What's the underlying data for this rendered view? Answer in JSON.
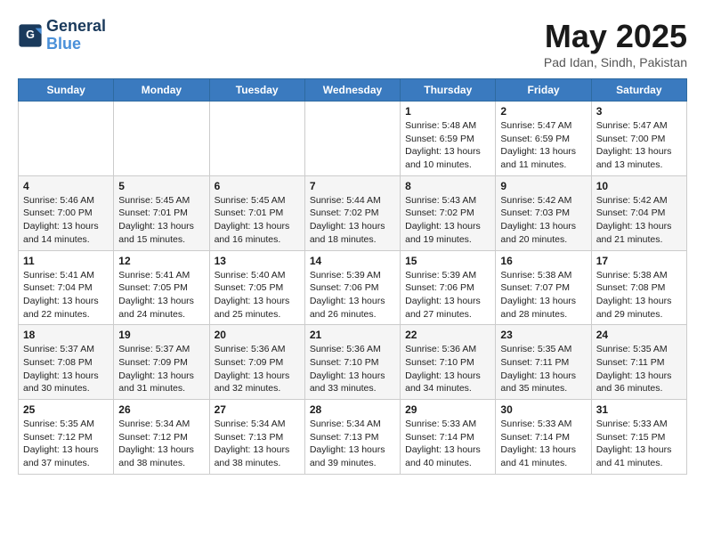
{
  "logo": {
    "line1": "General",
    "line2": "Blue"
  },
  "title": "May 2025",
  "location": "Pad Idan, Sindh, Pakistan",
  "headers": [
    "Sunday",
    "Monday",
    "Tuesday",
    "Wednesday",
    "Thursday",
    "Friday",
    "Saturday"
  ],
  "weeks": [
    [
      {
        "day": "",
        "info": ""
      },
      {
        "day": "",
        "info": ""
      },
      {
        "day": "",
        "info": ""
      },
      {
        "day": "",
        "info": ""
      },
      {
        "day": "1",
        "info": "Sunrise: 5:48 AM\nSunset: 6:59 PM\nDaylight: 13 hours\nand 10 minutes."
      },
      {
        "day": "2",
        "info": "Sunrise: 5:47 AM\nSunset: 6:59 PM\nDaylight: 13 hours\nand 11 minutes."
      },
      {
        "day": "3",
        "info": "Sunrise: 5:47 AM\nSunset: 7:00 PM\nDaylight: 13 hours\nand 13 minutes."
      }
    ],
    [
      {
        "day": "4",
        "info": "Sunrise: 5:46 AM\nSunset: 7:00 PM\nDaylight: 13 hours\nand 14 minutes."
      },
      {
        "day": "5",
        "info": "Sunrise: 5:45 AM\nSunset: 7:01 PM\nDaylight: 13 hours\nand 15 minutes."
      },
      {
        "day": "6",
        "info": "Sunrise: 5:45 AM\nSunset: 7:01 PM\nDaylight: 13 hours\nand 16 minutes."
      },
      {
        "day": "7",
        "info": "Sunrise: 5:44 AM\nSunset: 7:02 PM\nDaylight: 13 hours\nand 18 minutes."
      },
      {
        "day": "8",
        "info": "Sunrise: 5:43 AM\nSunset: 7:02 PM\nDaylight: 13 hours\nand 19 minutes."
      },
      {
        "day": "9",
        "info": "Sunrise: 5:42 AM\nSunset: 7:03 PM\nDaylight: 13 hours\nand 20 minutes."
      },
      {
        "day": "10",
        "info": "Sunrise: 5:42 AM\nSunset: 7:04 PM\nDaylight: 13 hours\nand 21 minutes."
      }
    ],
    [
      {
        "day": "11",
        "info": "Sunrise: 5:41 AM\nSunset: 7:04 PM\nDaylight: 13 hours\nand 22 minutes."
      },
      {
        "day": "12",
        "info": "Sunrise: 5:41 AM\nSunset: 7:05 PM\nDaylight: 13 hours\nand 24 minutes."
      },
      {
        "day": "13",
        "info": "Sunrise: 5:40 AM\nSunset: 7:05 PM\nDaylight: 13 hours\nand 25 minutes."
      },
      {
        "day": "14",
        "info": "Sunrise: 5:39 AM\nSunset: 7:06 PM\nDaylight: 13 hours\nand 26 minutes."
      },
      {
        "day": "15",
        "info": "Sunrise: 5:39 AM\nSunset: 7:06 PM\nDaylight: 13 hours\nand 27 minutes."
      },
      {
        "day": "16",
        "info": "Sunrise: 5:38 AM\nSunset: 7:07 PM\nDaylight: 13 hours\nand 28 minutes."
      },
      {
        "day": "17",
        "info": "Sunrise: 5:38 AM\nSunset: 7:08 PM\nDaylight: 13 hours\nand 29 minutes."
      }
    ],
    [
      {
        "day": "18",
        "info": "Sunrise: 5:37 AM\nSunset: 7:08 PM\nDaylight: 13 hours\nand 30 minutes."
      },
      {
        "day": "19",
        "info": "Sunrise: 5:37 AM\nSunset: 7:09 PM\nDaylight: 13 hours\nand 31 minutes."
      },
      {
        "day": "20",
        "info": "Sunrise: 5:36 AM\nSunset: 7:09 PM\nDaylight: 13 hours\nand 32 minutes."
      },
      {
        "day": "21",
        "info": "Sunrise: 5:36 AM\nSunset: 7:10 PM\nDaylight: 13 hours\nand 33 minutes."
      },
      {
        "day": "22",
        "info": "Sunrise: 5:36 AM\nSunset: 7:10 PM\nDaylight: 13 hours\nand 34 minutes."
      },
      {
        "day": "23",
        "info": "Sunrise: 5:35 AM\nSunset: 7:11 PM\nDaylight: 13 hours\nand 35 minutes."
      },
      {
        "day": "24",
        "info": "Sunrise: 5:35 AM\nSunset: 7:11 PM\nDaylight: 13 hours\nand 36 minutes."
      }
    ],
    [
      {
        "day": "25",
        "info": "Sunrise: 5:35 AM\nSunset: 7:12 PM\nDaylight: 13 hours\nand 37 minutes."
      },
      {
        "day": "26",
        "info": "Sunrise: 5:34 AM\nSunset: 7:12 PM\nDaylight: 13 hours\nand 38 minutes."
      },
      {
        "day": "27",
        "info": "Sunrise: 5:34 AM\nSunset: 7:13 PM\nDaylight: 13 hours\nand 38 minutes."
      },
      {
        "day": "28",
        "info": "Sunrise: 5:34 AM\nSunset: 7:13 PM\nDaylight: 13 hours\nand 39 minutes."
      },
      {
        "day": "29",
        "info": "Sunrise: 5:33 AM\nSunset: 7:14 PM\nDaylight: 13 hours\nand 40 minutes."
      },
      {
        "day": "30",
        "info": "Sunrise: 5:33 AM\nSunset: 7:14 PM\nDaylight: 13 hours\nand 41 minutes."
      },
      {
        "day": "31",
        "info": "Sunrise: 5:33 AM\nSunset: 7:15 PM\nDaylight: 13 hours\nand 41 minutes."
      }
    ]
  ]
}
